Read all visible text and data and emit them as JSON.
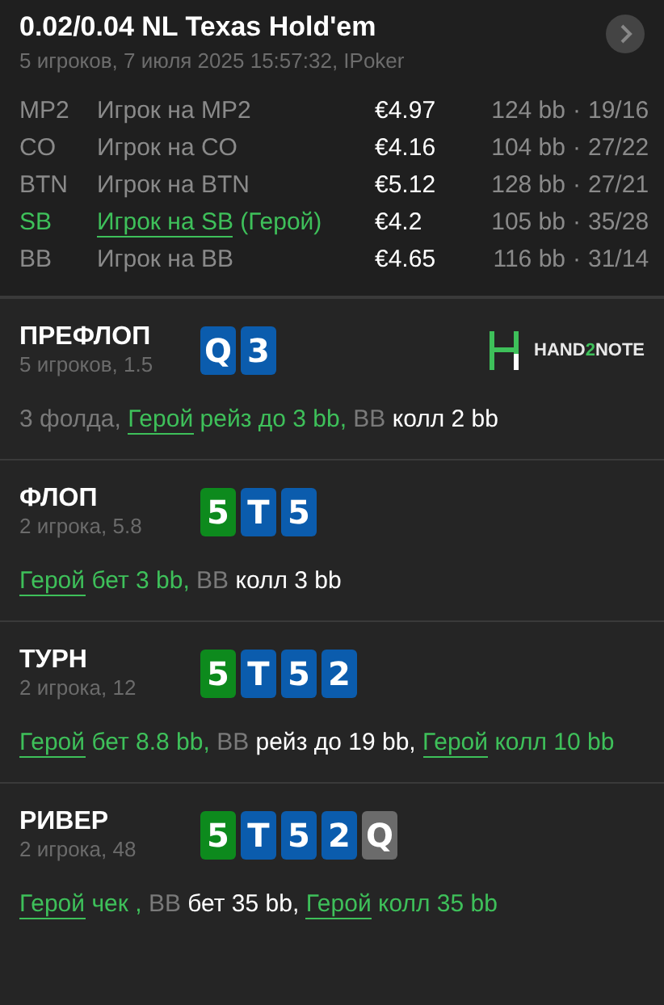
{
  "header": {
    "title": "0.02/0.04 NL Texas Hold'em",
    "subtitle": "5 игроков, 7 июля 2025 15:57:32, IPoker"
  },
  "players": [
    {
      "position": "MP2",
      "name": "Игрок на MP2",
      "hero": false,
      "stack": "€4.97",
      "bb": "124 bb",
      "separator": "·",
      "stats": "19/16"
    },
    {
      "position": "CO",
      "name": "Игрок на CO",
      "hero": false,
      "stack": "€4.16",
      "bb": "104 bb",
      "separator": "·",
      "stats": "27/22"
    },
    {
      "position": "BTN",
      "name": "Игрок на BTN",
      "hero": false,
      "stack": "€5.12",
      "bb": "128 bb",
      "separator": "·",
      "stats": "27/21"
    },
    {
      "position": "SB",
      "name": "Игрок на SB",
      "hero": true,
      "hero_tag": "(Герой)",
      "stack": "€4.2",
      "bb": "105 bb",
      "separator": "·",
      "stats": "35/28"
    },
    {
      "position": "BB",
      "name": "Игрок на BB",
      "hero": false,
      "stack": "€4.65",
      "bb": "116 bb",
      "separator": "·",
      "stats": "31/14"
    }
  ],
  "logo": {
    "parts": [
      {
        "text": "HAND",
        "accent": false
      },
      {
        "text": "2",
        "accent": true
      },
      {
        "text": "NOTE",
        "accent": false
      }
    ]
  },
  "streets": [
    {
      "name": "ПРЕФЛОП",
      "info": "5 игроков, 1.5",
      "cards": [
        {
          "rank": "Q",
          "color": "#0b5cad"
        },
        {
          "rank": "3",
          "color": "#0b5cad"
        }
      ],
      "actions": [
        {
          "kind": "muted",
          "text": "3 фолда,"
        },
        {
          "kind": "hero-name",
          "text": "Герой"
        },
        {
          "kind": "hero",
          "text": "рейз до 3 bb,"
        },
        {
          "kind": "muted",
          "text": "BB"
        },
        {
          "kind": "plain",
          "text": "колл 2 bb"
        }
      ]
    },
    {
      "name": "ФЛОП",
      "info": "2 игрока, 5.8",
      "cards": [
        {
          "rank": "5",
          "color": "#0d8a1d"
        },
        {
          "rank": "T",
          "color": "#0b5cad"
        },
        {
          "rank": "5",
          "color": "#0b5cad"
        }
      ],
      "actions": [
        {
          "kind": "hero-name",
          "text": "Герой"
        },
        {
          "kind": "hero",
          "text": "бет 3 bb,"
        },
        {
          "kind": "muted",
          "text": "BB"
        },
        {
          "kind": "plain",
          "text": "колл 3 bb"
        }
      ]
    },
    {
      "name": "ТУРН",
      "info": "2 игрока, 12",
      "cards": [
        {
          "rank": "5",
          "color": "#0d8a1d"
        },
        {
          "rank": "T",
          "color": "#0b5cad"
        },
        {
          "rank": "5",
          "color": "#0b5cad"
        },
        {
          "rank": "2",
          "color": "#0b5cad"
        }
      ],
      "actions": [
        {
          "kind": "hero-name",
          "text": "Герой"
        },
        {
          "kind": "hero",
          "text": "бет 8.8 bb,"
        },
        {
          "kind": "muted",
          "text": "BB"
        },
        {
          "kind": "plain",
          "text": "рейз до 19 bb,"
        },
        {
          "kind": "hero-name",
          "text": "Герой"
        },
        {
          "kind": "hero",
          "text": "колл 10 bb"
        }
      ]
    },
    {
      "name": "РИВЕР",
      "info": "2 игрока, 48",
      "cards": [
        {
          "rank": "5",
          "color": "#0d8a1d"
        },
        {
          "rank": "T",
          "color": "#0b5cad"
        },
        {
          "rank": "5",
          "color": "#0b5cad"
        },
        {
          "rank": "2",
          "color": "#0b5cad"
        },
        {
          "rank": "Q",
          "color": "#6b6b6b"
        }
      ],
      "actions": [
        {
          "kind": "hero-name",
          "text": "Герой"
        },
        {
          "kind": "hero",
          "text": "чек ,"
        },
        {
          "kind": "muted",
          "text": "BB"
        },
        {
          "kind": "plain",
          "text": "бет 35 bb,"
        },
        {
          "kind": "hero-name",
          "text": "Герой"
        },
        {
          "kind": "hero",
          "text": "колл 35 bb"
        }
      ]
    }
  ]
}
